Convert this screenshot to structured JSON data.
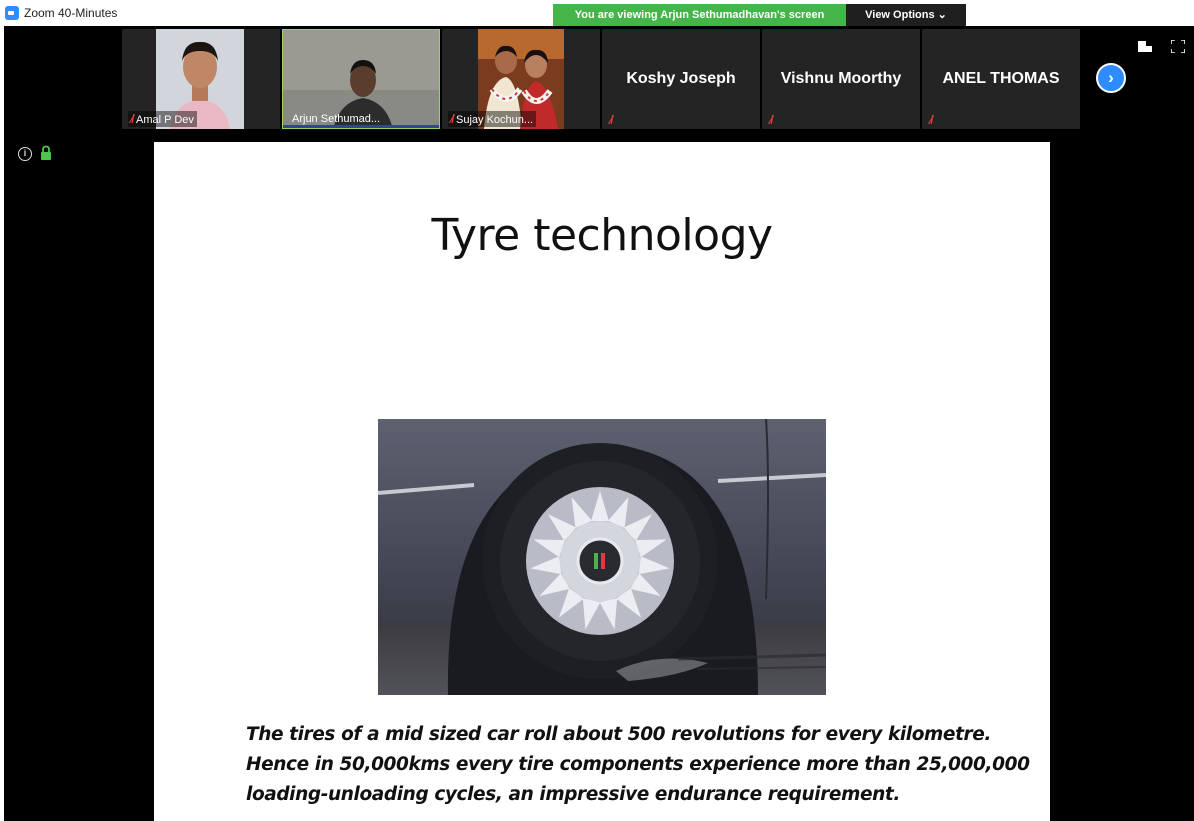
{
  "window": {
    "title": "Zoom 40-Minutes"
  },
  "banner": {
    "viewing_text": "You are viewing Arjun Sethumadhavan's screen",
    "view_options_label": "View Options ⌄"
  },
  "participants": [
    {
      "name": "Amal P Dev",
      "muted": true,
      "has_video": true
    },
    {
      "name": "Arjun Sethumad...",
      "muted": false,
      "has_video": true
    },
    {
      "name": "Sujay Kochun...",
      "muted": true,
      "has_video": true
    },
    {
      "name": "Koshy Joseph",
      "muted": true,
      "has_video": false
    },
    {
      "name": "Vishnu Moorthy",
      "muted": true,
      "has_video": false
    },
    {
      "name": "ANEL THOMAS",
      "muted": true,
      "has_video": false
    }
  ],
  "controls": {
    "next_glyph": "›",
    "info_glyph": "i"
  },
  "icons": {
    "app": "zoom-app-icon",
    "mute": "muted-mic-icon",
    "next": "chevron-right-icon",
    "layout": "gallery-layout-icon",
    "fullscreen": "fullscreen-icon",
    "info": "info-icon",
    "lock": "lock-icon"
  },
  "colors": {
    "banner_green": "#44b649",
    "accent_blue": "#2d8cff",
    "lock_green": "#4cc64a",
    "mute_red": "#e0413b"
  },
  "slide": {
    "title": "Tyre technology",
    "caption_lines": [
      "The tires of a mid sized car roll about 500 revolutions for every kilometre.",
      "Hence in 50,000kms  every tire components experience more than 25,000,000",
      "loading-unloading cycles, an impressive endurance requirement."
    ]
  }
}
